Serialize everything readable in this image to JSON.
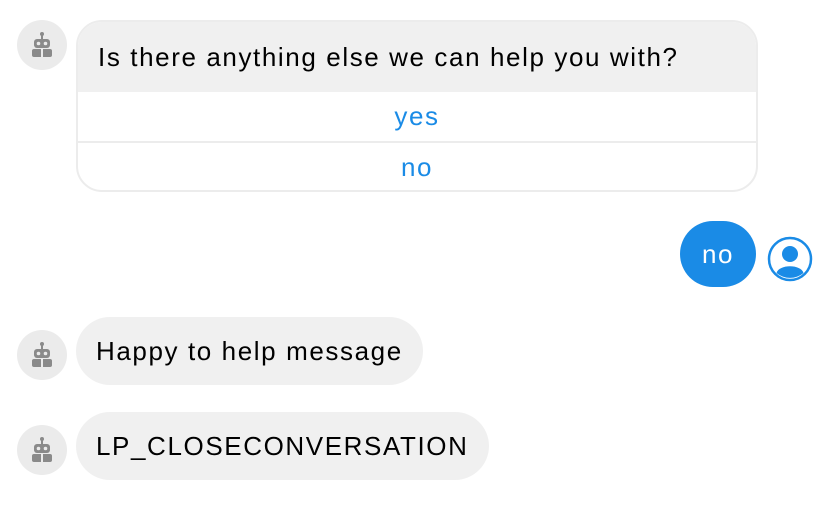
{
  "conversation": {
    "question_card": {
      "question": "Is there anything else we can help you with?",
      "options": [
        "yes",
        "no"
      ]
    },
    "user_reply": "no",
    "bot_messages": [
      "Happy to help message",
      "LP_CLOSECONVERSATION"
    ]
  },
  "icons": {
    "bot_avatar": "robot-icon",
    "user_avatar": "user-icon"
  },
  "colors": {
    "accent": "#1a8be6",
    "bot_bubble": "#f0f0f0",
    "avatar_bg": "#ebebeb",
    "robot_gray": "#8a8a8a"
  }
}
